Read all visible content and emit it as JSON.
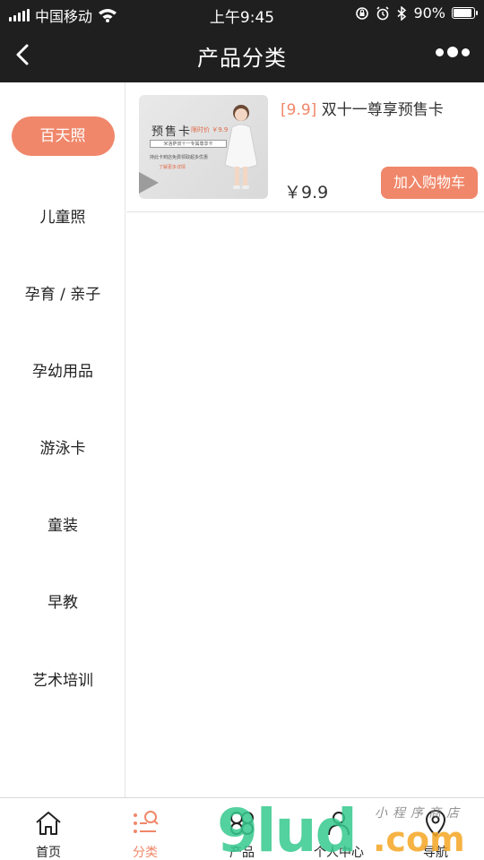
{
  "status_bar": {
    "carrier": "中国移动",
    "time": "上午9:45",
    "battery": "90%",
    "battery_level": 0.9
  },
  "nav": {
    "title": "产品分类",
    "back_icon": "chevron-left-icon",
    "more_icon": "more-dots-icon"
  },
  "categories": [
    {
      "label": "百天照",
      "active": true
    },
    {
      "label": "儿童照"
    },
    {
      "label": "孕育 / 亲子"
    },
    {
      "label": "孕幼用品"
    },
    {
      "label": "游泳卡"
    },
    {
      "label": "童装"
    },
    {
      "label": "早教"
    },
    {
      "label": "艺术培训"
    }
  ],
  "product": {
    "tag": "[9.9]",
    "name": "双十一尊享预售卡",
    "price": "￥9.9",
    "cart_button": "加入购物车",
    "image": {
      "title": "预售卡",
      "price_text": "限时价 ￥9.9",
      "band_text": "米洛萨双十一专属尊享卡",
      "line_text": "持此卡到店免费领取超多优惠",
      "more_text": "了解更多详情"
    }
  },
  "tabs": [
    {
      "label": "首页",
      "icon": "home-icon"
    },
    {
      "label": "分类",
      "icon": "category-icon",
      "active": true
    },
    {
      "label": "产品",
      "icon": "product-icon"
    },
    {
      "label": "个人中心",
      "icon": "user-icon"
    },
    {
      "label": "导航",
      "icon": "location-pin-icon"
    }
  ],
  "watermark": {
    "brand": "9lud",
    "domain": ".com",
    "tagline": "小程序商店"
  },
  "colors": {
    "accent": "#f0876a",
    "header_bg": "#1f1f1f",
    "watermark_green": "#36c98e",
    "watermark_orange": "#f5a623"
  }
}
